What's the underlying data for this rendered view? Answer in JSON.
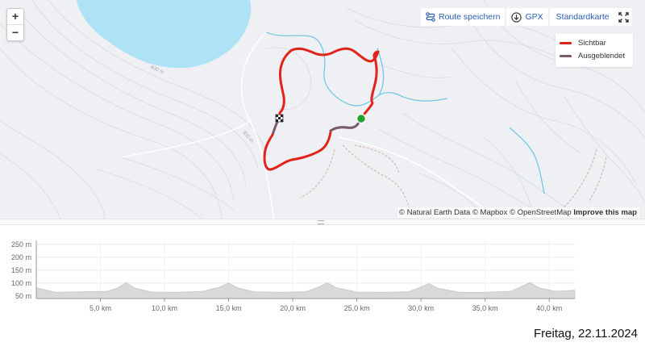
{
  "map": {
    "zoom_in": "+",
    "zoom_out": "−",
    "toolbar": {
      "save_route": "Route speichern",
      "gpx": "GPX",
      "map_style": "Standardkarte"
    },
    "legend": [
      {
        "label": "Sichtbar",
        "color": "#e2231a"
      },
      {
        "label": "Ausgeblendet",
        "color": "#7a5a6a"
      }
    ],
    "contour_labels": [
      "400 m",
      "300 m"
    ],
    "attribution": {
      "text": "© Natural Earth Data © Mapbox © OpenStreetMap",
      "link": "Improve this map"
    },
    "colors": {
      "route_visible": "#e2231a",
      "route_hidden": "#7a5a6a",
      "water": "#aee3f5",
      "river": "#6cc4e0",
      "start_marker": "#22a32f"
    }
  },
  "chart_data": {
    "type": "area",
    "title": "",
    "xlabel": "",
    "ylabel": "",
    "x_ticks": [
      "5,0 km",
      "10,0 km",
      "15,0 km",
      "20,0 km",
      "25,0 km",
      "30,0 km",
      "35,0 km",
      "40,0 km"
    ],
    "y_ticks": [
      "50 m",
      "100 m",
      "150 m",
      "200 m",
      "250 m"
    ],
    "xlim": [
      0,
      42
    ],
    "ylim": [
      40,
      265
    ],
    "series": [
      {
        "x": [
          0,
          1.5,
          3.5,
          5.5,
          6.3,
          7,
          7.7,
          9,
          11,
          13,
          14.3,
          15,
          15.7,
          17,
          19,
          21,
          22,
          22.7,
          23.4,
          25,
          27,
          29,
          30,
          30.6,
          31.3,
          33,
          35,
          37,
          37.8,
          38.5,
          39.2,
          40.5,
          42
        ],
        "y": [
          82,
          64,
          66,
          68,
          80,
          102,
          80,
          65,
          64,
          68,
          84,
          100,
          82,
          66,
          64,
          66,
          84,
          101,
          82,
          65,
          64,
          66,
          84,
          98,
          80,
          64,
          64,
          68,
          86,
          102,
          82,
          68,
          72
        ]
      }
    ]
  },
  "footer": {
    "date": "Freitag, 22.11.2024"
  }
}
